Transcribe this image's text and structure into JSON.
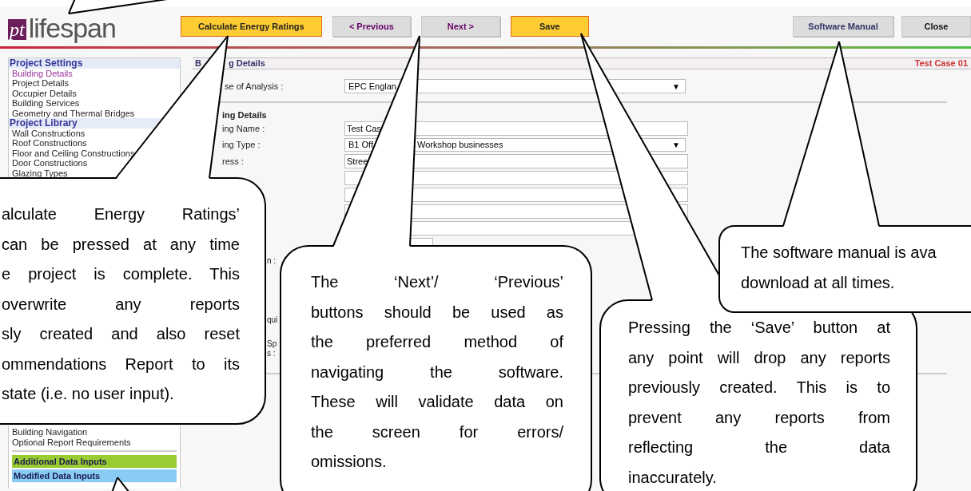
{
  "header": {
    "logo": {
      "mark": "pt",
      "name": "lifespan"
    },
    "buttons": [
      {
        "label": "Calculate Energy Ratings",
        "kind": "highlight"
      },
      {
        "label": "< Previous",
        "kind": "nav"
      },
      {
        "label": "Next >",
        "kind": "nav"
      },
      {
        "label": "Save",
        "kind": "highlight"
      }
    ],
    "right_buttons": [
      {
        "label": "Software Manual",
        "kind": "link"
      },
      {
        "label": "Close",
        "kind": "plain"
      }
    ]
  },
  "sidebar": {
    "groups": [
      {
        "title": "Project Settings",
        "items": [
          {
            "label": "Building Details",
            "selected": true
          },
          {
            "label": "Project Details",
            "selected": false
          },
          {
            "label": "Occupier Details",
            "selected": false
          },
          {
            "label": "Building Services",
            "selected": false
          },
          {
            "label": "Geometry and Thermal Bridges",
            "selected": false
          }
        ]
      },
      {
        "title": "Project Library",
        "items": [
          {
            "label": "Wall Constructions",
            "selected": false
          },
          {
            "label": "Roof Constructions",
            "selected": false
          },
          {
            "label": "Floor and Ceiling Constructions",
            "selected": false
          },
          {
            "label": "Door Constructions",
            "selected": false
          },
          {
            "label": "Glazing Types",
            "selected": false
          }
        ]
      }
    ],
    "lower_items": [
      {
        "label": "Building Navigation",
        "selected": false
      },
      {
        "label": "Optional Report Requirements",
        "selected": false
      }
    ],
    "sections": [
      {
        "label": "Additional Data Inputs",
        "color": "#99cc33"
      },
      {
        "label": "Modified Data Inputs",
        "color": "#88ccf4"
      }
    ]
  },
  "main": {
    "title_parts": [
      "B",
      "g Details"
    ],
    "case_name": "Test Case 01",
    "analysis": {
      "label": "se of Analysis :",
      "value": "EPC Englan",
      "symbol": "▼"
    },
    "subheading": "ing Details",
    "fields": [
      {
        "kind": "input",
        "label": "ing Name :",
        "value": "Test Cas"
      },
      {
        "kind": "select",
        "label": "ing Type :",
        "value_parts": [
          "B1 Off",
          "Workshop businesses"
        ],
        "symbol": "▼"
      },
      {
        "kind": "input",
        "label": "ress :",
        "value": "Stree"
      },
      {
        "kind": "input"
      },
      {
        "kind": "input"
      },
      {
        "kind": "input"
      },
      {
        "kind": "input"
      },
      {
        "kind": "small"
      }
    ],
    "fragments": [
      "n :",
      "qui",
      "Sp",
      "s :"
    ]
  },
  "callouts": [
    {
      "lines": [
        "alculate Energy Ratings’",
        "can be pressed at any time",
        "e project is complete. This",
        "overwrite any reports",
        "sly created and also reset",
        "ommendations Report to its",
        "state (i.e. no user input)."
      ]
    },
    {
      "lines": [
        "The ‘Next’/ ‘Previous’",
        "buttons should be used as",
        "the preferred method of",
        "navigating the software.",
        "These will validate data on",
        "the screen for errors/",
        "omissions."
      ]
    },
    {
      "lines": [
        "Pressing the ‘Save’ button at",
        "any point will drop any reports",
        "previously created. This is to",
        "prevent any reports from",
        "reflecting the data",
        "inaccurately."
      ]
    },
    {
      "lines": [
        "The software manual is ava",
        "download at all times."
      ]
    }
  ]
}
